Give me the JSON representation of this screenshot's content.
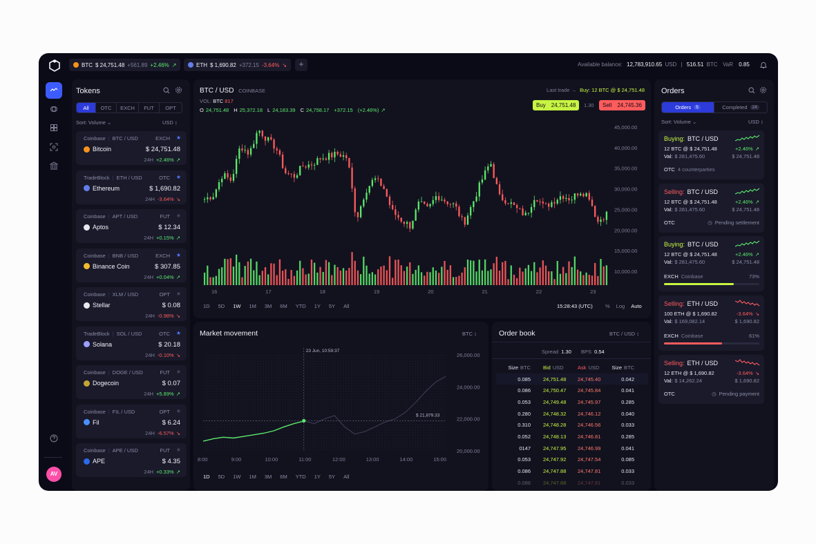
{
  "topbar": {
    "tickers": [
      {
        "symbol": "BTC",
        "price": "$ 24,751.48",
        "delta": "+561.89",
        "pct": "+2.46%",
        "arrow": "↗",
        "color": "#f7931a"
      },
      {
        "symbol": "ETH",
        "price": "$ 1,690.82",
        "delta": "+372.15",
        "pct": "-3.64%",
        "arrow": "↘",
        "color": "#627eea"
      }
    ],
    "add_label": "+",
    "balance_label": "Available balance:",
    "balance_value": "12,783,910.65",
    "balance_unit": "USD",
    "btc_value": "516.51",
    "btc_unit": "BTC",
    "var_label": "VaR",
    "var_value": "0.85"
  },
  "sidebar": {
    "avatar": "AV"
  },
  "tokens": {
    "title": "Tokens",
    "filters": [
      "All",
      "OTC",
      "EXCH",
      "FUT",
      "OPT"
    ],
    "active_filter": "All",
    "sort_label": "Sort: Volume",
    "sort_arrow": "⌄",
    "currency": "USD",
    "currency_arrow": "↕",
    "items": [
      {
        "exchange": "Coinbase",
        "pair": "BTC / USD",
        "type": "EXCH",
        "starred": true,
        "name": "Bitcoin",
        "price": "$ 24,751.48",
        "period": "24H",
        "change": "+2.46%",
        "arrow": "↗",
        "up": true,
        "color": "#f7931a"
      },
      {
        "exchange": "TradeBlock",
        "pair": "ETH / USD",
        "type": "OTC",
        "starred": true,
        "name": "Ethereum",
        "price": "$ 1,690.82",
        "period": "24H",
        "change": "-3.64%",
        "arrow": "↘",
        "up": false,
        "color": "#627eea"
      },
      {
        "exchange": "Coinbase",
        "pair": "APT / USD",
        "type": "FUT",
        "starred": false,
        "name": "Aptos",
        "price": "$ 12.34",
        "period": "24H",
        "change": "+0.15%",
        "arrow": "↗",
        "up": true,
        "color": "#e6e8f0"
      },
      {
        "exchange": "Coinbase",
        "pair": "BNB / USD",
        "type": "EXCH",
        "starred": true,
        "name": "Binance Coin",
        "price": "$ 307.85",
        "period": "24H",
        "change": "+0.04%",
        "arrow": "↗",
        "up": true,
        "color": "#f3ba2f"
      },
      {
        "exchange": "Coinbase",
        "pair": "XLM / USD",
        "type": "OPT",
        "starred": false,
        "name": "Stellar",
        "price": "$ 0.08",
        "period": "24H",
        "change": "-0.98%",
        "arrow": "↘",
        "up": false,
        "color": "#e6e8f0"
      },
      {
        "exchange": "TradeBlock",
        "pair": "SOL / USD",
        "type": "OTC",
        "starred": true,
        "name": "Solana",
        "price": "$ 20.18",
        "period": "24H",
        "change": "-0.10%",
        "arrow": "↘",
        "up": false,
        "color": "#9aa0ff"
      },
      {
        "exchange": "Coinbase",
        "pair": "DOGE / USD",
        "type": "FUT",
        "starred": false,
        "name": "Dogecoin",
        "price": "$ 0.07",
        "period": "24H",
        "change": "+5.89%",
        "arrow": "↗",
        "up": true,
        "color": "#c2a633"
      },
      {
        "exchange": "Coinbase",
        "pair": "FIL / USD",
        "type": "OPT",
        "starred": false,
        "name": "Fil",
        "price": "$ 6.24",
        "period": "24H",
        "change": "-6.57%",
        "arrow": "↘",
        "up": false,
        "color": "#4a90ff"
      },
      {
        "exchange": "Coinbase",
        "pair": "APE / USD",
        "type": "FUT",
        "starred": false,
        "name": "APE",
        "price": "$ 4.35",
        "period": "24H",
        "change": "+0.33%",
        "arrow": "↗",
        "up": true,
        "color": "#2b6ae6"
      }
    ]
  },
  "main_chart": {
    "pair": "BTC / USD",
    "exchange": "COINBASE",
    "vol_label": "VOL:",
    "vol_unit": "BTC",
    "vol_value": "817",
    "ohlc": {
      "o_label": "O",
      "o": "24,751.48",
      "h_label": "H",
      "h": "25,372.18",
      "l_label": "L",
      "l": "24,183.39",
      "c_label": "C",
      "c": "24,758.17",
      "delta": "+372.15",
      "pct": "(+2.46%)",
      "arrow": "↗"
    },
    "last_trade_label": "Last trade →",
    "last_trade": "Buy: 12 BTC @ $ 24,751.48",
    "buy_label": "Buy",
    "buy_price": "24,751.48",
    "spread": "1.30",
    "sell_label": "Sell",
    "sell_price": "24,745.36",
    "ranges": [
      "1D",
      "5D",
      "1W",
      "1M",
      "3M",
      "6M",
      "YTD",
      "1Y",
      "5Y",
      "All"
    ],
    "active_range": "1W",
    "time": "15:28:43 (UTC)",
    "pct_toggle": "%",
    "log_toggle": "Log",
    "auto_toggle": "Auto"
  },
  "market_movement": {
    "title": "Market movement",
    "currency": "BTC",
    "currency_arrow": "↕",
    "tooltip": "23 Jun, 10:59:37",
    "price_label": "$ 21,879.33",
    "ranges": [
      "1D",
      "5D",
      "1W",
      "1M",
      "3M",
      "6M",
      "YTD",
      "1Y",
      "5Y",
      "All"
    ],
    "active_range": "1D"
  },
  "order_book": {
    "title": "Order book",
    "pair": "BTC / USD",
    "pair_arrow": "↕",
    "spread_label": "Spread",
    "spread": "1.30",
    "bps_label": "BPS",
    "bps": "0.54",
    "headers": [
      {
        "t": "Size",
        "u": "BTC"
      },
      {
        "t": "Bid",
        "u": "USD"
      },
      {
        "t": "Ask",
        "u": "USD"
      },
      {
        "t": "Size",
        "u": "BTC"
      }
    ],
    "rows": [
      [
        "0.085",
        "24,751.48",
        "24,745.40",
        "0.042"
      ],
      [
        "0.086",
        "24,750.47",
        "24,745.84",
        "0.041"
      ],
      [
        "0.053",
        "24,749.48",
        "24,745.97",
        "0.285"
      ],
      [
        "0.280",
        "24,748.32",
        "24,746.12",
        "0.040"
      ],
      [
        "0.310",
        "24,748.28",
        "24,746.56",
        "0.033"
      ],
      [
        "0.052",
        "24,748.13",
        "24,746.81",
        "0.285"
      ],
      [
        "0147",
        "24,747.95",
        "24,746.99",
        "0.041"
      ],
      [
        "0.053",
        "24,747.92",
        "24,747.54",
        "0.085"
      ],
      [
        "0.086",
        "24,747.88",
        "24,747.81",
        "0.033"
      ],
      [
        "0.086",
        "24,747.88",
        "24,747.81",
        "0.033"
      ]
    ]
  },
  "orders": {
    "title": "Orders",
    "tab_orders": "Orders",
    "tab_orders_count": "5",
    "tab_completed": "Completed",
    "tab_completed_count": "24",
    "sort_label": "Sort: Volume",
    "sort_arrow": "⌄",
    "currency": "USD",
    "currency_arrow": "↕",
    "items": [
      {
        "side": "Buying:",
        "pair": "BTC / USD",
        "qty": "12 BTC @ $ 24,751.48",
        "val_label": "Val:",
        "val": "$ 281,475.60",
        "pct": "+2.46%",
        "arrow": "↗",
        "right_val": "$ 24,751.48",
        "footer": "OTC",
        "footer_extra": "4 counterparties",
        "status": "",
        "progress_pct": "",
        "progress": 0
      },
      {
        "side": "Selling:",
        "pair": "BTC / USD",
        "qty": "12 BTC @ $ 24,751.48",
        "val_label": "Val:",
        "val": "$ 281,475.60",
        "pct": "+2.46%",
        "arrow": "↗",
        "right_val": "$ 24,751.48",
        "footer": "OTC",
        "footer_extra": "",
        "status": "Pending settlement",
        "progress_pct": "",
        "progress": 0
      },
      {
        "side": "Buying:",
        "pair": "BTC / USD",
        "qty": "12 BTC @ $ 24,751.48",
        "val_label": "Val:",
        "val": "$ 281,475.60",
        "pct": "+2.46%",
        "arrow": "↗",
        "right_val": "$ 24,751.48",
        "footer": "EXCH",
        "footer_extra": "Coinbase",
        "status": "",
        "progress_pct": "73%",
        "progress": 0.73
      },
      {
        "side": "Selling:",
        "pair": "ETH / USD",
        "qty": "100 ETH @ $ 1,690.82",
        "val_label": "Val:",
        "val": "$ 169,082.14",
        "pct": "-3.64%",
        "arrow": "↘",
        "right_val": "$ 1,690.82",
        "footer": "EXCH",
        "footer_extra": "Coinbase",
        "status": "",
        "progress_pct": "61%",
        "progress": 0.61
      },
      {
        "side": "Selling:",
        "pair": "ETH / USD",
        "qty": "12 ETH @ $ 1,690.82",
        "val_label": "Val:",
        "val": "$ 14,262.24",
        "pct": "-3.64%",
        "arrow": "↘",
        "right_val": "$ 1,690.82",
        "footer": "OTC",
        "footer_extra": "",
        "status": "Pending payment",
        "progress_pct": "",
        "progress": 0
      }
    ]
  },
  "chart_data": [
    {
      "type": "candlestick",
      "title": "BTC / USD",
      "x_ticks": [
        "16",
        "17",
        "18",
        "19",
        "20",
        "21",
        "22",
        "23"
      ],
      "y_ticks": [
        "45,000.00",
        "40,000.00",
        "35,000.00",
        "30,000.00",
        "25,000.00",
        "20,000.00",
        "15,000.00",
        "10,000.00"
      ],
      "ylim": [
        10000,
        45000
      ],
      "close_path": [
        27500,
        28500,
        33500,
        32000,
        40500,
        38500,
        44500,
        42000,
        40000,
        34000,
        33000,
        35500,
        36000,
        37500,
        38000,
        38500,
        37500,
        22500,
        29500,
        32500,
        30500,
        24500,
        22500,
        21000,
        26500,
        25000,
        28500,
        27000,
        26000,
        21500,
        26500,
        32000,
        36500,
        28000,
        27000,
        25000,
        23500,
        28500,
        25500,
        27000,
        28500,
        27500,
        29500,
        28500,
        22000,
        24000
      ],
      "volume": {
        "min": 8000,
        "max": 16000
      }
    },
    {
      "type": "line",
      "title": "Market movement",
      "x_ticks": [
        "8:00",
        "9:00",
        "10:00",
        "11:00",
        "12:00",
        "13:00",
        "14:00",
        "15:00"
      ],
      "y_ticks": [
        "26,000.00",
        "24,000.00",
        "22,000.00",
        "20,000.00"
      ],
      "ylim": [
        20000,
        26000
      ],
      "x": [
        8,
        8.3,
        8.6,
        8.9,
        9.2,
        9.5,
        9.8,
        10.1,
        10.4,
        10.7,
        10.99,
        11.3,
        11.6,
        11.9,
        12.2,
        12.5,
        12.8,
        13.1,
        13.4,
        13.7,
        14,
        14.3,
        14.6,
        14.9,
        15.2
      ],
      "y": [
        20600,
        20750,
        20850,
        20800,
        20900,
        21000,
        21100,
        21250,
        21500,
        21700,
        21850,
        21700,
        22000,
        22200,
        21500,
        21050,
        21200,
        21500,
        21800,
        22000,
        22400,
        23000,
        23700,
        24300,
        24650
      ],
      "highlight_x": 10.99,
      "highlight_y": 21879.33
    }
  ]
}
